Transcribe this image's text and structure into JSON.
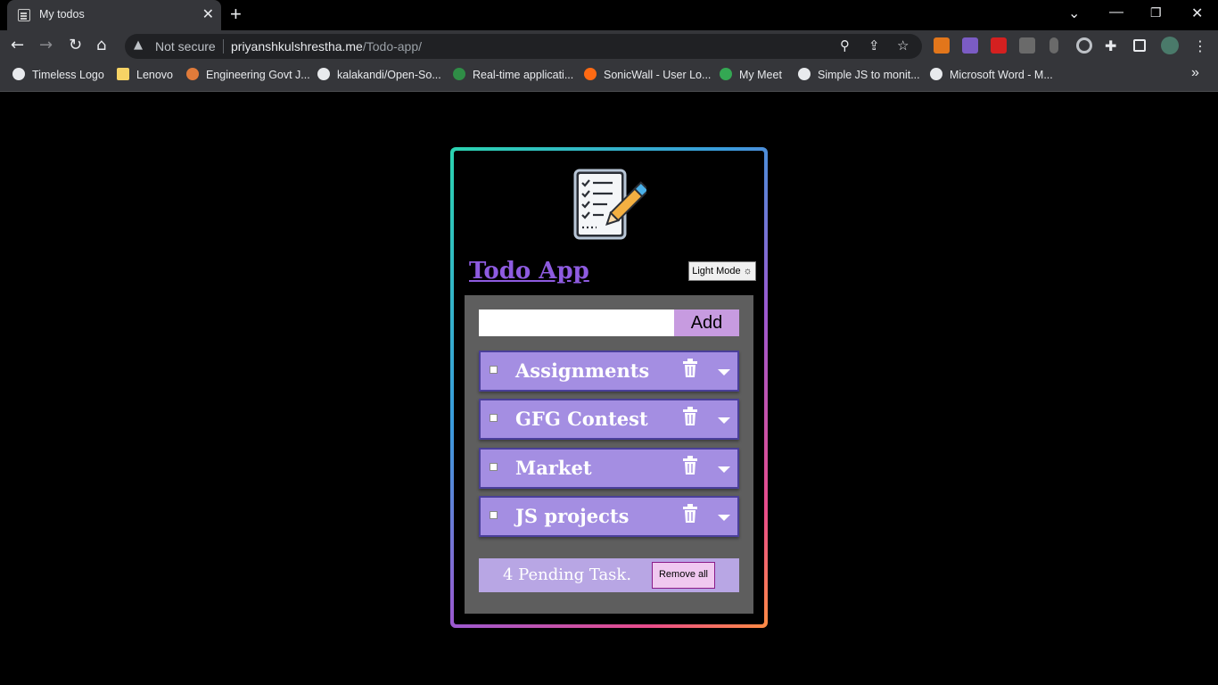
{
  "browser": {
    "tab_title": "My todos",
    "close_glyph": "✕",
    "new_tab_glyph": "+",
    "security_label": "Not secure",
    "url_domain": "priyanshkulshrestha.me",
    "url_path": "/Todo-app/",
    "bookmarks": [
      {
        "label": "Timeless Logo",
        "icon": "globe-icon",
        "color": "#e8eaed"
      },
      {
        "label": "Lenovo",
        "icon": "folder-icon",
        "color": "#f6d365"
      },
      {
        "label": "Engineering Govt J...",
        "icon": "rocket-icon",
        "color": "#e07b3a"
      },
      {
        "label": "kalakandi/Open-So...",
        "icon": "github-icon",
        "color": "#e8eaed"
      },
      {
        "label": "Real-time applicati...",
        "icon": "gfg-icon",
        "color": "#2f8d46"
      },
      {
        "label": "SonicWall - User Lo...",
        "icon": "sonicwall-icon",
        "color": "#ff6a13"
      },
      {
        "label": "My Meet",
        "icon": "meet-icon",
        "color": "#34a853"
      },
      {
        "label": "Simple JS to monit...",
        "icon": "github-icon",
        "color": "#e8eaed"
      },
      {
        "label": "Microsoft Word - M...",
        "icon": "globe-icon",
        "color": "#e8eaed"
      }
    ],
    "overflow_glyph": "»"
  },
  "app": {
    "title": "Todo App",
    "mode_button": "Light Mode ☼",
    "input_value": "",
    "add_label": "Add",
    "tasks": [
      {
        "label": "Assignments"
      },
      {
        "label": "GFG Contest"
      },
      {
        "label": "Market"
      },
      {
        "label": "JS projects"
      }
    ],
    "pending_text": "4 Pending Task.",
    "remove_all_label": "Remove all",
    "colors": {
      "title": "#8e5be0",
      "task_bg": "#a48ee2",
      "add_bg": "#c79be0",
      "panel_bg": "#5e5e5e"
    }
  }
}
